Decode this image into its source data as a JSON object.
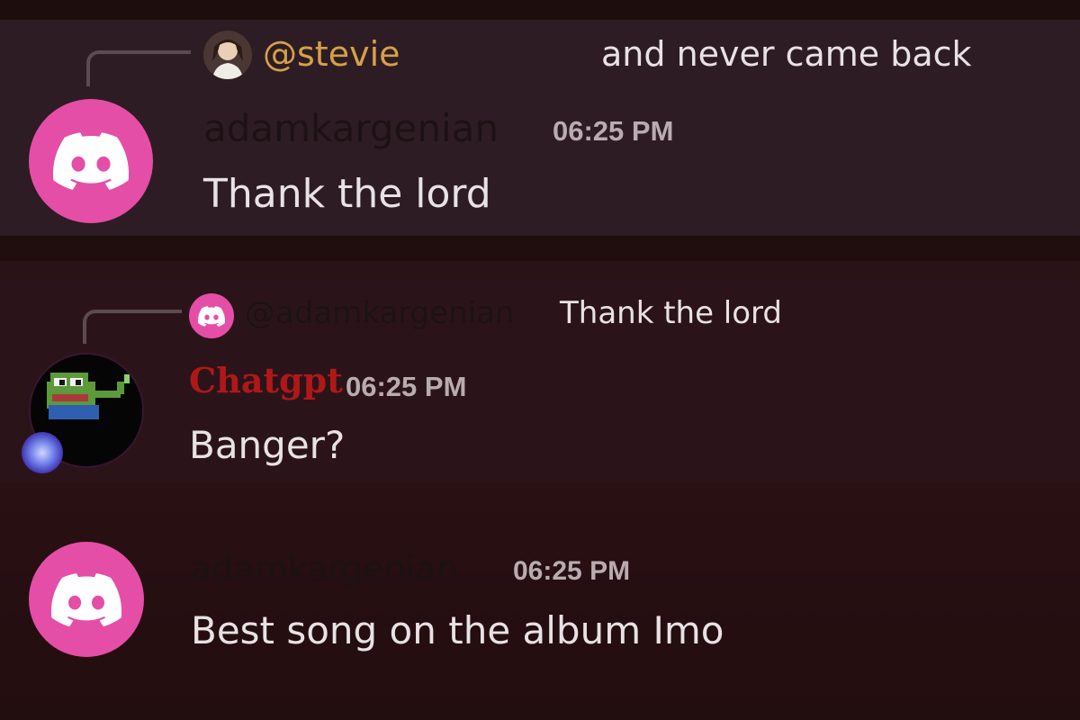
{
  "messages": [
    {
      "reply": {
        "mention": "@stevie",
        "mention_color": "#d4a14a",
        "text": "and never came back"
      },
      "author": "adamkargenian",
      "author_color": "#1c1214",
      "timestamp": "06:25 PM",
      "body": "Thank the lord",
      "avatar": "discord-logo-icon"
    },
    {
      "reply": {
        "mention": "@adamkargenian",
        "mention_color": "#1c1214",
        "text": "Thank the lord"
      },
      "author": "Chatgpt",
      "author_color": "#b01818",
      "timestamp": "06:25 PM",
      "body": "Banger?",
      "avatar": "pepe-frog-icon"
    },
    {
      "author": "adamkargenian",
      "author_color": "#1c1214",
      "timestamp": "06:25 PM",
      "body": "Best song on the album Imo",
      "avatar": "discord-logo-icon"
    }
  ],
  "colors": {
    "discord_pink": "#e54ea6",
    "text": "#e8e2e4",
    "timestamp": "#b8acb0"
  }
}
